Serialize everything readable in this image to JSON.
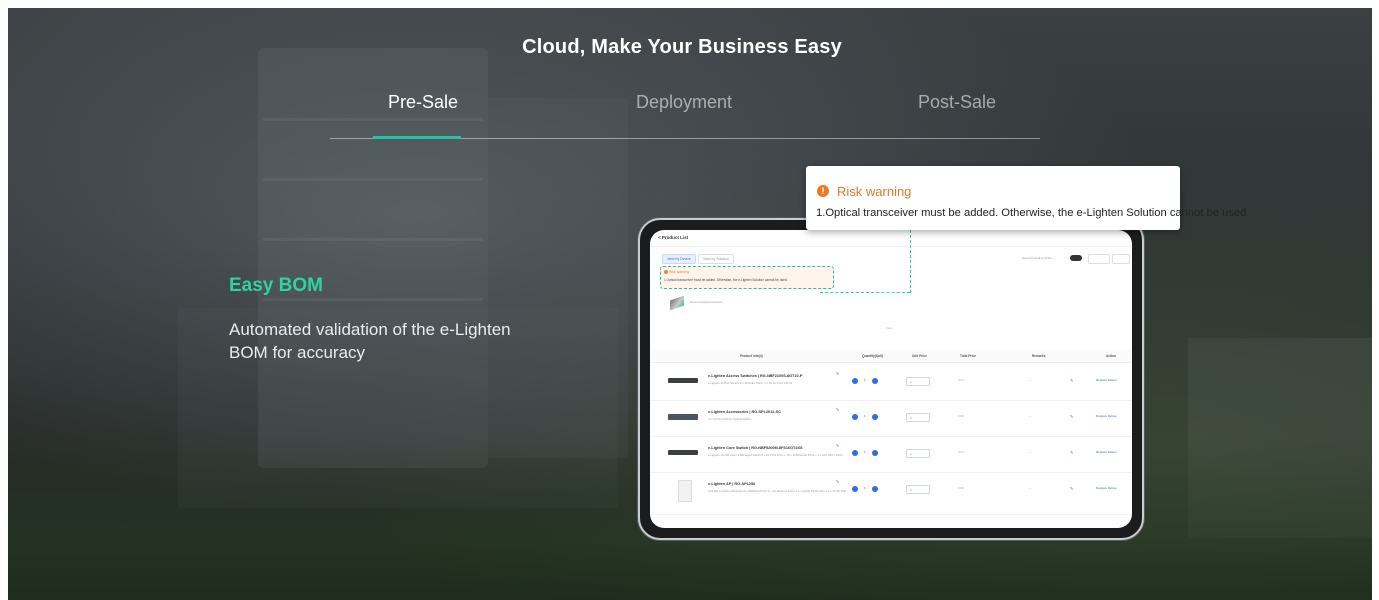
{
  "headline": "Cloud, Make Your Business Easy",
  "tabs": [
    {
      "label": "Pre-Sale",
      "active": true
    },
    {
      "label": "Deployment",
      "active": false
    },
    {
      "label": "Post-Sale",
      "active": false
    }
  ],
  "accent_color": "#23c4a4",
  "feature": {
    "title": "Easy BOM",
    "description": "Automated validation of the e-Lighten BOM for accuracy"
  },
  "popup": {
    "title": "Risk warning",
    "message": "1.Optical transceiver must be added. Otherwise, the e-Lighten Solution cannot be used."
  },
  "tablet": {
    "title": "< Product List",
    "view_buttons": [
      "View by Device",
      "View by Solution"
    ],
    "export_label": "Export Including Scale",
    "risk": {
      "title": "Risk warning",
      "message": "1.Optical transceiver must be added. Otherwise, the e-Lighten Solution cannot be used."
    },
    "recommended": "Recommended selection",
    "more": "more",
    "columns": [
      "Product Info(4)",
      "Quantity(Unit)",
      "Unit Price",
      "Total Price",
      "Remarks",
      "Action"
    ],
    "rows": [
      {
        "name": "e-Lighten Access Switches | RG-NBF2100S-8GT10-P",
        "desc": "e-Lighten 10 Port Switch, 8 x 10 PoE+ Ports, 1 x 10 SC Port, 120 W",
        "qty": "1",
        "price": "0",
        "total": "0.00",
        "remarks": "—",
        "actions": "Replace  Delete"
      },
      {
        "name": "e-Lighten Accessories | RG-SPL2012-SC",
        "desc": "2 in 12 Out Uniform Optical Splitter",
        "qty": "1",
        "price": "0",
        "total": "0.00",
        "remarks": "—",
        "actions": "Replace  Delete"
      },
      {
        "name": "e-Lighten Core Switch | RG-NBF5200M-8FS16GT4XS",
        "desc": "e-Lighten 16-100 Layer 3 Managed Switch 8 x 10 PON Ports + 16 x 10 Ethernet Ports + 4 x 10G SFP+ Ports",
        "qty": "1",
        "price": "0",
        "total": "0.00",
        "remarks": "—",
        "actions": "Replace  Delete"
      },
      {
        "name": "e-Lighten AP | RG-AP1250",
        "desc": "AC1300 e-Lighten Multi-Service Wall Mount AP, 2 x 1G Ethernet Ports + 1 x Uplink Phone Port + 1 x 10 SC Port",
        "qty": "1",
        "price": "0",
        "total": "0.00",
        "remarks": "—",
        "actions": "Replace  Delete"
      }
    ]
  }
}
